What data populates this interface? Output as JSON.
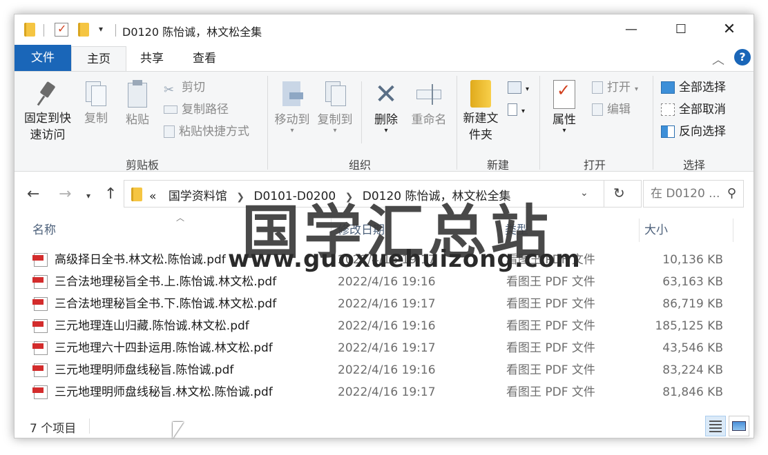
{
  "window": {
    "title": "D0120 陈怡诚，林文松全集",
    "minimize_icon": "minimize-icon",
    "maximize_icon": "maximize-icon",
    "close_icon": "close-icon"
  },
  "ribbon_tabs": [
    {
      "label": "文件"
    },
    {
      "label": "主页"
    },
    {
      "label": "共享"
    },
    {
      "label": "查看"
    }
  ],
  "ribbon": {
    "clipboard": {
      "pin_label": "固定到快速访问",
      "copy_label": "复制",
      "paste_label": "粘贴",
      "cut_label": "剪切",
      "copy_path_label": "复制路径",
      "paste_shortcut_label": "粘贴快捷方式",
      "group_label": "剪贴板"
    },
    "organize": {
      "move_label": "移动到",
      "copy_to_label": "复制到",
      "delete_label": "删除",
      "rename_label": "重命名",
      "group_label": "组织"
    },
    "new": {
      "new_folder_label": "新建文件夹",
      "group_label": "新建"
    },
    "open": {
      "properties_label": "属性",
      "open_label": "打开",
      "edit_label": "编辑",
      "group_label": "打开"
    },
    "select": {
      "select_all_label": "全部选择",
      "select_none_label": "全部取消",
      "invert_label": "反向选择",
      "group_label": "选择"
    }
  },
  "address": {
    "overflow": "«",
    "crumbs": [
      "国学资料馆",
      "D0101-D0200",
      "D0120 陈怡诚，林文松全集"
    ],
    "search_placeholder": "在 D0120 ..."
  },
  "columns": {
    "name": "名称",
    "date": "修改日期",
    "type": "类型",
    "size": "大小"
  },
  "files": [
    {
      "name": "高级择日全书.林文松.陈怡诚.pdf",
      "date": "2022/4/16 19:17",
      "type": "看图王 PDF 文件",
      "size": "10,136 KB"
    },
    {
      "name": "三合法地理秘旨全书.上.陈怡诚.林文松.pdf",
      "date": "2022/4/16 19:16",
      "type": "看图王 PDF 文件",
      "size": "63,163 KB"
    },
    {
      "name": "三合法地理秘旨全书.下.陈怡诚.林文松.pdf",
      "date": "2022/4/16 19:17",
      "type": "看图王 PDF 文件",
      "size": "86,719 KB"
    },
    {
      "name": "三元地理连山归藏.陈怡诚.林文松.pdf",
      "date": "2022/4/16 19:16",
      "type": "看图王 PDF 文件",
      "size": "185,125 KB"
    },
    {
      "name": "三元地理六十四卦运用.陈怡诚.林文松.pdf",
      "date": "2022/4/16 19:17",
      "type": "看图王 PDF 文件",
      "size": "43,546 KB"
    },
    {
      "name": "三元地理明师盘线秘旨.陈怡诚.pdf",
      "date": "2022/4/16 19:16",
      "type": "看图王 PDF 文件",
      "size": "83,224 KB"
    },
    {
      "name": "三元地理明师盘线秘旨.林文松.陈怡诚.pdf",
      "date": "2022/4/16 19:17",
      "type": "看图王 PDF 文件",
      "size": "81,846 KB"
    }
  ],
  "status": {
    "item_count": "7 个项目"
  },
  "watermark": {
    "title": "国学汇总站",
    "url": "www.guoxuehuizong.com"
  },
  "colors": {
    "file_tab": "#1a66b8",
    "ribbon_bg": "#f5f6f7",
    "header_text": "#4c607a"
  }
}
